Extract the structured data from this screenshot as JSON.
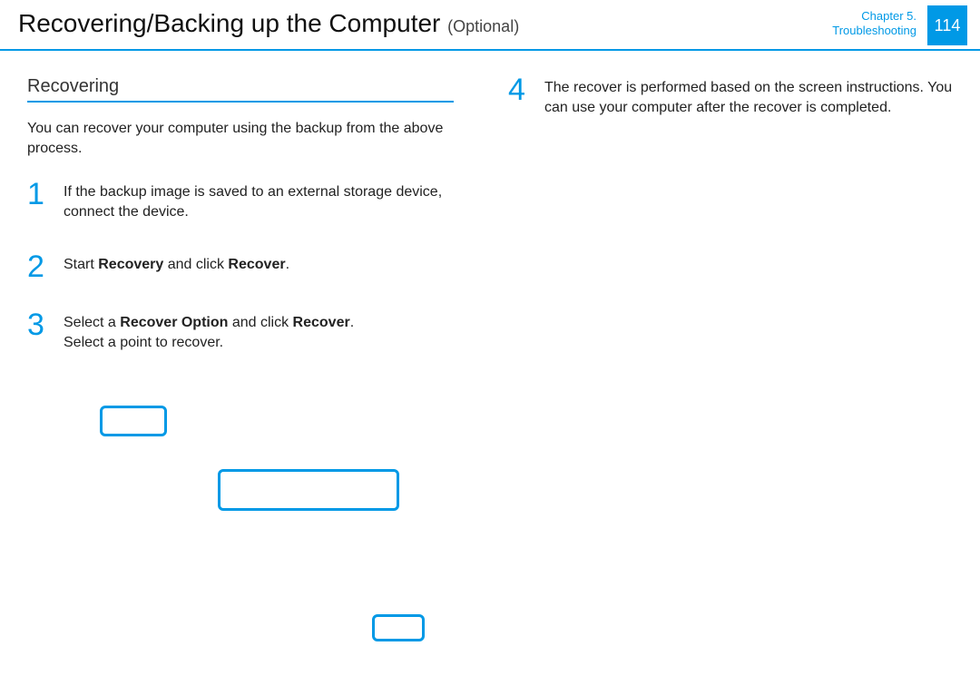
{
  "header": {
    "title_main": "Recovering/Backing up the Computer",
    "title_tag": "(Optional)",
    "chapter_line": "Chapter 5.",
    "section_line": "Troubleshooting",
    "page_number": "114"
  },
  "left": {
    "section_heading": "Recovering",
    "intro": "You can recover your computer using the backup from the above process.",
    "steps": [
      {
        "num": "1",
        "text": "If the backup image is saved to an external storage device, connect the device."
      },
      {
        "num": "2",
        "prefix": "Start ",
        "bold1": "Recovery",
        "mid": " and click ",
        "bold2": "Recover",
        "suffix": "."
      },
      {
        "num": "3",
        "line1_prefix": "Select a ",
        "line1_bold1": "Recover Option",
        "line1_mid": " and click ",
        "line1_bold2": "Recover",
        "line1_suffix": ".",
        "line2": "Select a point to recover."
      }
    ]
  },
  "right": {
    "step": {
      "num": "4",
      "text": "The recover is performed based on the screen instructions. You can use your computer after the recover is completed."
    }
  }
}
